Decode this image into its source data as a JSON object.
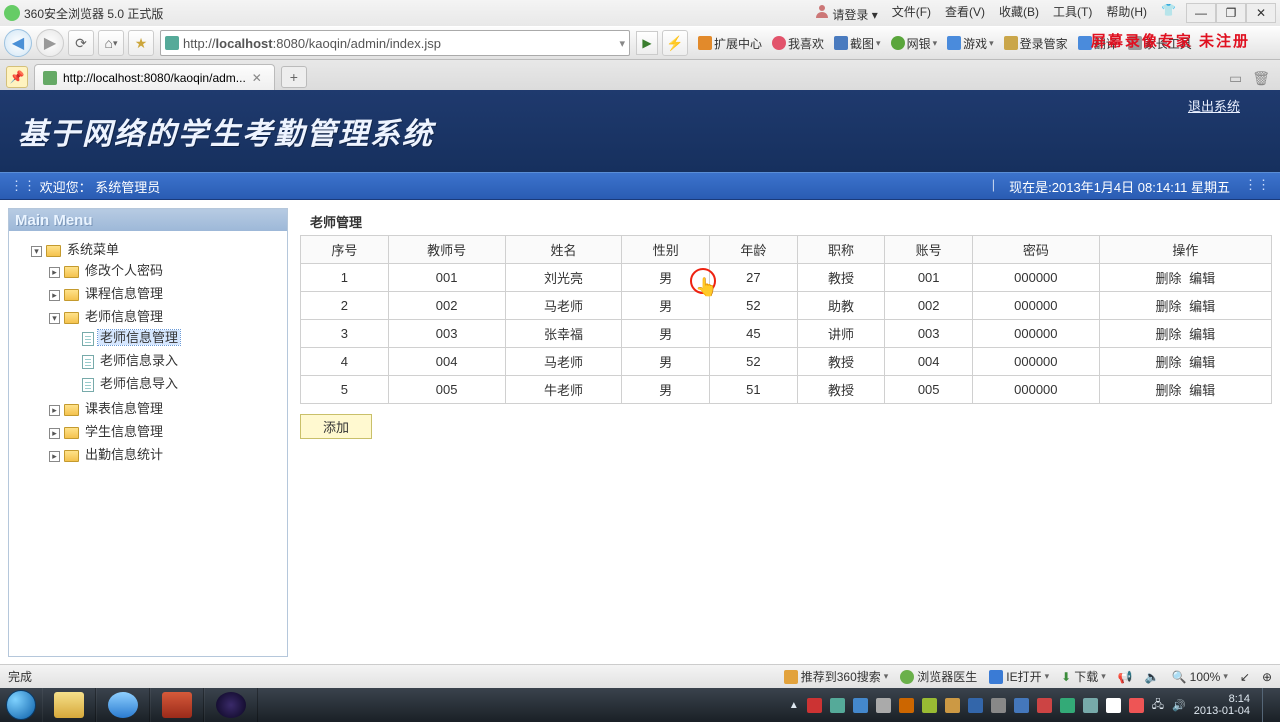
{
  "browser": {
    "title": "360安全浏览器 5.0 正式版",
    "login": "请登录",
    "menus": {
      "file": "文件(F)",
      "view": "查看(V)",
      "favorite": "收藏(B)",
      "tools": "工具(T)",
      "help": "帮助(H)"
    },
    "url_display": "http://localhost:8080/kaoqin/admin/index.jsp",
    "url_bold_host": "localhost",
    "tab_title": "http://localhost:8080/kaoqin/adm...",
    "right_tools": {
      "ext": "扩展中心",
      "like": "我喜欢",
      "shot": "截图",
      "net": "网银",
      "game": "游戏",
      "login_mgr": "登录管家",
      "translate": "翻译",
      "parent": "家长工具"
    },
    "watermark": "屏幕录像专家 未注册"
  },
  "page": {
    "sys_title": "基于网络的学生考勤管理系统",
    "logout": "退出系统",
    "welcome_prefix": "欢迎您：",
    "welcome_role": "系统管理员",
    "now_label": "现在是:",
    "now_time": "2013年1月4日  08:14:11 星期五"
  },
  "sidebar": {
    "header": "Main Menu",
    "root": "系统菜单",
    "items": [
      {
        "label": "修改个人密码",
        "type": "folder"
      },
      {
        "label": "课程信息管理",
        "type": "folder"
      },
      {
        "label": "老师信息管理",
        "type": "folder",
        "expanded": true,
        "children": [
          {
            "label": "老师信息管理",
            "type": "file",
            "selected": true
          },
          {
            "label": "老师信息录入",
            "type": "file"
          },
          {
            "label": "老师信息导入",
            "type": "file"
          }
        ]
      },
      {
        "label": "课表信息管理",
        "type": "folder"
      },
      {
        "label": "学生信息管理",
        "type": "folder"
      },
      {
        "label": "出勤信息统计",
        "type": "folder"
      }
    ]
  },
  "content": {
    "panel_title": "老师管理",
    "headers": [
      "序号",
      "教师号",
      "姓名",
      "性别",
      "年龄",
      "职称",
      "账号",
      "密码",
      "操作"
    ],
    "rows": [
      {
        "idx": "1",
        "no": "001",
        "name": "刘光亮",
        "sex": "男",
        "age": "27",
        "title": "教授",
        "acct": "001",
        "pwd": "000000"
      },
      {
        "idx": "2",
        "no": "002",
        "name": "马老师",
        "sex": "男",
        "age": "52",
        "title": "助教",
        "acct": "002",
        "pwd": "000000"
      },
      {
        "idx": "3",
        "no": "003",
        "name": "张幸福",
        "sex": "男",
        "age": "45",
        "title": "讲师",
        "acct": "003",
        "pwd": "000000"
      },
      {
        "idx": "4",
        "no": "004",
        "name": "马老师",
        "sex": "男",
        "age": "52",
        "title": "教授",
        "acct": "004",
        "pwd": "000000"
      },
      {
        "idx": "5",
        "no": "005",
        "name": "牛老师",
        "sex": "男",
        "age": "51",
        "title": "教授",
        "acct": "005",
        "pwd": "000000"
      }
    ],
    "op_delete": "删除",
    "op_edit": "编辑",
    "add_button": "添加"
  },
  "statusbar": {
    "done": "完成",
    "recommend": "推荐到360搜索",
    "doctor": "浏览器医生",
    "ie_open": "IE打开",
    "download": "下载",
    "zoom": "100%"
  },
  "taskbar": {
    "time": "8:14",
    "date": "2013-01-04"
  }
}
